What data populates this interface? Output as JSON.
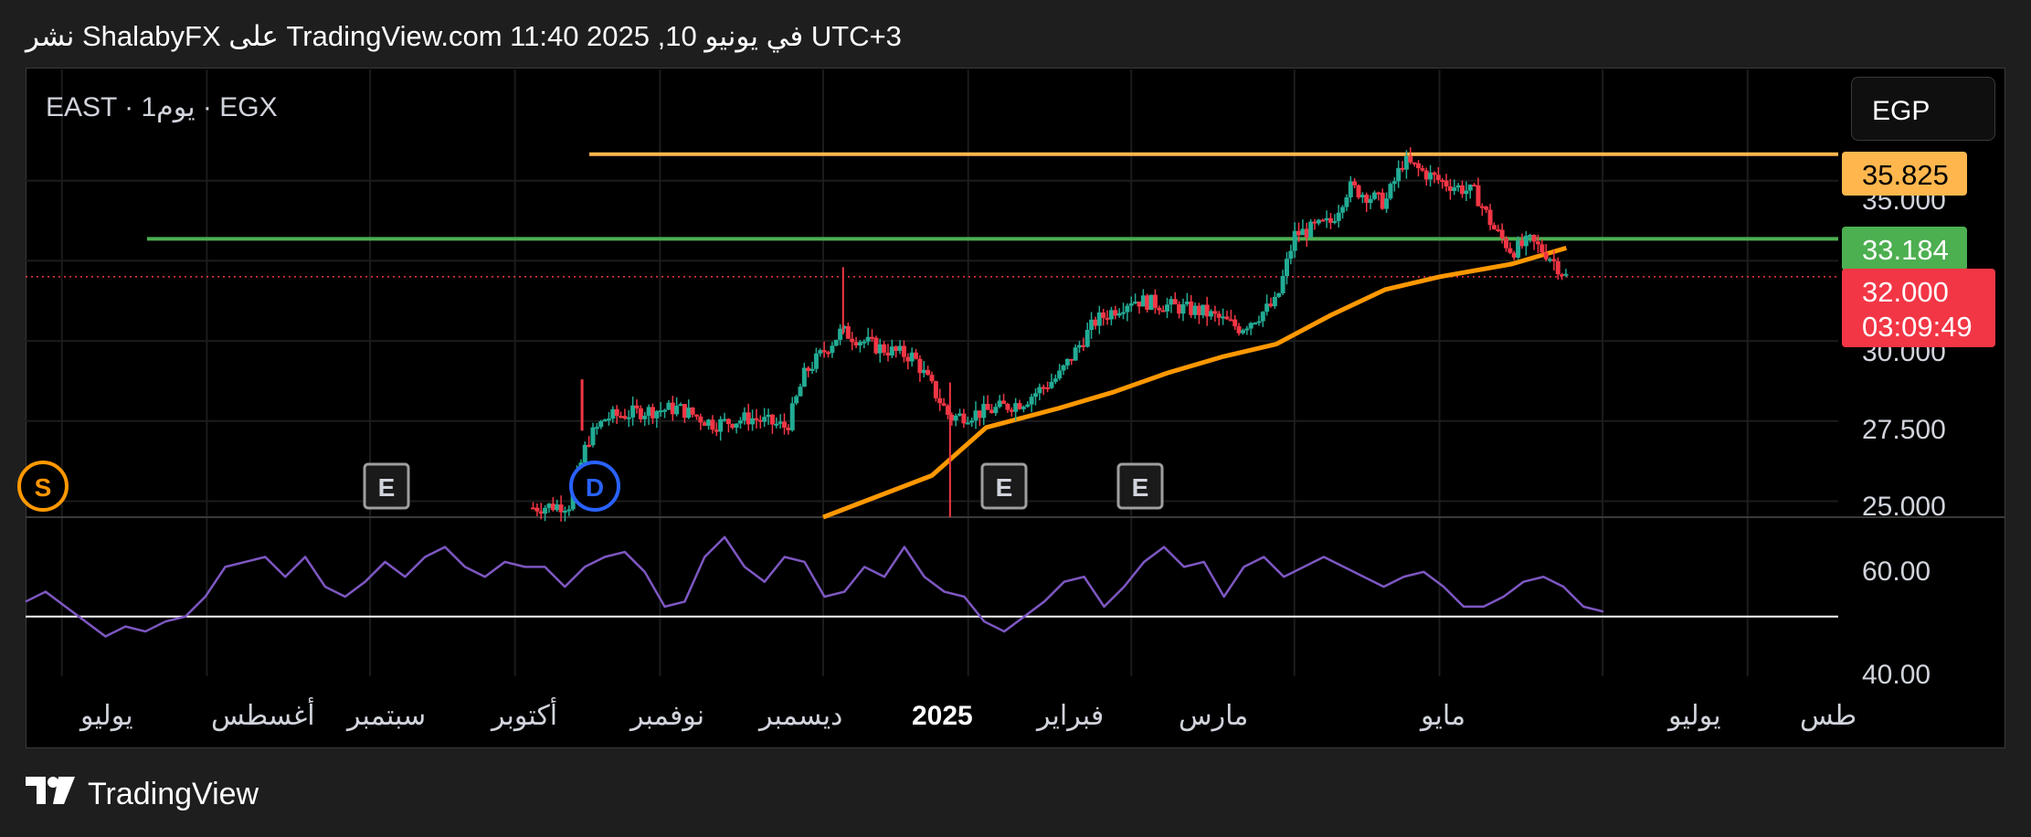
{
  "header": {
    "text": "نشر ShalabyFX على TradingView.com 11:40 2025 ,10 في يونيو UTC+3"
  },
  "symbol_label": "EAST · 1يوم · EGX",
  "currency_button": "EGP",
  "footer": {
    "brand": "TradingView"
  },
  "colors": {
    "up": "#22ab94",
    "down": "#f23645",
    "ma": "#ff9800",
    "resistance": "#ffb74d",
    "support": "#4caf50",
    "rsi": "#7e57c2",
    "price_tag": "#f23645"
  },
  "chart_data": {
    "type": "candlestick",
    "x_axis": {
      "labels": [
        "يوليو",
        "أغسطس",
        "سبتمبر",
        "أكتوبر",
        "نوفمبر",
        "ديسمبر",
        "2025",
        "فبراير",
        "مارس",
        "مايو",
        "يوليو",
        "طس"
      ]
    },
    "price_axis": {
      "ticks": [
        "35.000",
        "30.000",
        "27.500",
        "25.000"
      ],
      "ylim": [
        24.5,
        37.5
      ]
    },
    "horizontal_lines": [
      {
        "name": "resistance",
        "value": 35.825,
        "label": "35.825"
      },
      {
        "name": "support",
        "value": 33.184,
        "label": "33.184"
      }
    ],
    "last_price": {
      "value": 32.0,
      "label": "32.000",
      "countdown": "03:09:49"
    },
    "moving_average": {
      "points": [
        [
          0.44,
          24.5
        ],
        [
          0.5,
          25.8
        ],
        [
          0.53,
          27.3
        ],
        [
          0.57,
          27.9
        ],
        [
          0.6,
          28.4
        ],
        [
          0.63,
          29.0
        ],
        [
          0.66,
          29.5
        ],
        [
          0.69,
          29.9
        ],
        [
          0.72,
          30.8
        ],
        [
          0.75,
          31.6
        ],
        [
          0.78,
          32.0
        ],
        [
          0.82,
          32.4
        ],
        [
          0.85,
          32.9
        ]
      ]
    },
    "candles_summary": {
      "segments": [
        [
          0.28,
          24.8
        ],
        [
          0.3,
          24.9
        ],
        [
          0.31,
          26.9
        ],
        [
          0.32,
          27.6
        ],
        [
          0.34,
          27.8
        ],
        [
          0.36,
          27.9
        ],
        [
          0.38,
          27.4
        ],
        [
          0.4,
          27.6
        ],
        [
          0.42,
          27.3
        ],
        [
          0.43,
          29.0
        ],
        [
          0.45,
          30.3
        ],
        [
          0.47,
          29.8
        ],
        [
          0.49,
          29.5
        ],
        [
          0.51,
          27.6
        ],
        [
          0.53,
          27.8
        ],
        [
          0.55,
          28.1
        ],
        [
          0.57,
          28.9
        ],
        [
          0.59,
          30.6
        ],
        [
          0.61,
          31.3
        ],
        [
          0.63,
          31.1
        ],
        [
          0.65,
          30.9
        ],
        [
          0.67,
          30.4
        ],
        [
          0.69,
          31.2
        ],
        [
          0.7,
          33.3
        ],
        [
          0.72,
          33.7
        ],
        [
          0.73,
          34.8
        ],
        [
          0.75,
          34.3
        ],
        [
          0.76,
          35.6
        ],
        [
          0.78,
          35.0
        ],
        [
          0.8,
          34.6
        ],
        [
          0.81,
          33.5
        ],
        [
          0.82,
          32.8
        ],
        [
          0.83,
          33.1
        ],
        [
          0.84,
          32.7
        ],
        [
          0.85,
          32.0
        ]
      ]
    },
    "events": [
      {
        "type": "S",
        "label": "S"
      },
      {
        "type": "E",
        "label": "E"
      },
      {
        "type": "D",
        "label": "D"
      },
      {
        "type": "E",
        "label": "E"
      },
      {
        "type": "E",
        "label": "E"
      }
    ],
    "rsi": {
      "ticks": [
        "60.00",
        "40.00"
      ],
      "ylim": [
        38,
        70
      ],
      "reference_level": 50,
      "values": [
        53,
        55,
        52,
        49,
        46,
        48,
        47,
        49,
        50,
        54,
        60,
        61,
        62,
        58,
        62,
        56,
        54,
        57,
        61,
        58,
        62,
        64,
        60,
        58,
        61,
        60,
        60,
        56,
        60,
        62,
        63,
        59,
        52,
        53,
        62,
        66,
        60,
        57,
        62,
        61,
        54,
        55,
        60,
        58,
        64,
        58,
        55,
        54,
        49,
        47,
        50,
        53,
        57,
        58,
        52,
        56,
        61,
        64,
        60,
        61,
        54,
        60,
        62,
        58,
        60,
        62,
        60,
        58,
        56,
        58,
        59,
        56,
        52,
        52,
        54,
        57,
        58,
        56,
        52,
        51
      ]
    }
  }
}
